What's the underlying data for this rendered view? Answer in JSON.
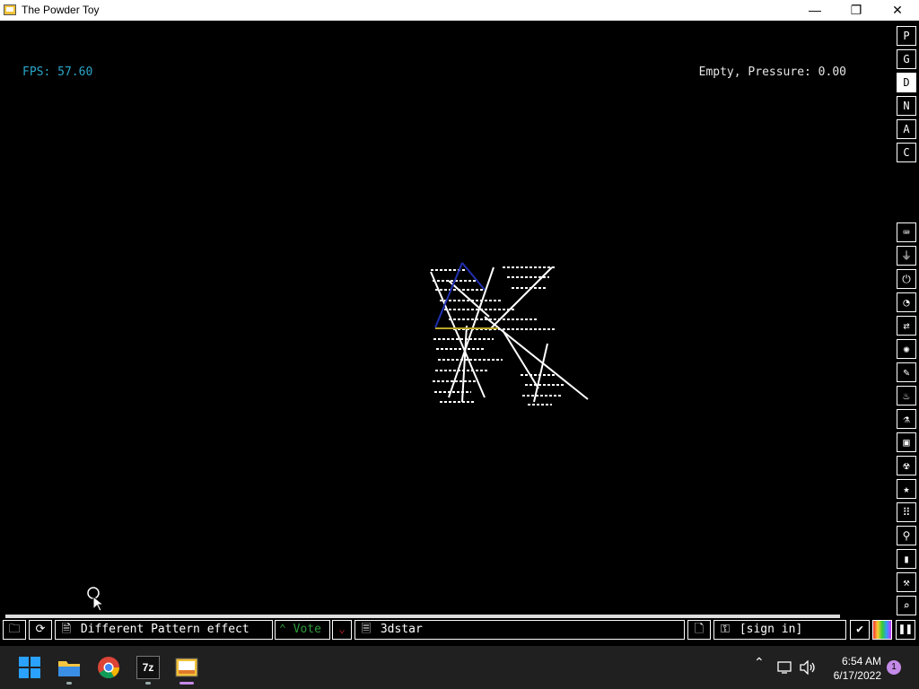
{
  "window": {
    "title": "The Powder Toy",
    "minimize_glyph": "—",
    "maximize_glyph": "❐",
    "close_glyph": "✕"
  },
  "hud": {
    "fps": "FPS: 57.60",
    "status": "Empty, Pressure: 0.00"
  },
  "side_panel_top": [
    {
      "label": "P",
      "active": false
    },
    {
      "label": "G",
      "active": false
    },
    {
      "label": "D",
      "active": true
    },
    {
      "label": "N",
      "active": false
    },
    {
      "label": "A",
      "active": false
    },
    {
      "label": "C",
      "active": false
    }
  ],
  "tool_categories": [
    {
      "icon": "keyboard-icon",
      "glyph": "⌨"
    },
    {
      "icon": "plug-icon",
      "glyph": "⏚"
    },
    {
      "icon": "power-icon",
      "glyph": "⏻"
    },
    {
      "icon": "gauge-icon",
      "glyph": "◔"
    },
    {
      "icon": "arrows-icon",
      "glyph": "⇄"
    },
    {
      "icon": "explosion-icon",
      "glyph": "✺"
    },
    {
      "icon": "pen-icon",
      "glyph": "✎"
    },
    {
      "icon": "flame-icon",
      "glyph": "♨"
    },
    {
      "icon": "flask-icon",
      "glyph": "⚗"
    },
    {
      "icon": "square-icon",
      "glyph": "▣"
    },
    {
      "icon": "radiation-icon",
      "glyph": "☢"
    },
    {
      "icon": "star-icon",
      "glyph": "★"
    },
    {
      "icon": "stairs-icon",
      "glyph": "⠿"
    },
    {
      "icon": "bulb-icon",
      "glyph": "⚲"
    },
    {
      "icon": "bookmark-icon",
      "glyph": "▮"
    },
    {
      "icon": "wrench-icon",
      "glyph": "⚒"
    },
    {
      "icon": "search-icon",
      "glyph": "⌕"
    }
  ],
  "bottom_bar": {
    "save_title": "Different Pattern effect",
    "vote_label": "Vote",
    "author": "3dstar",
    "sign_in": "[sign in]"
  },
  "taskbar": {
    "time": "6:54 AM",
    "date": "6/17/2022",
    "notification_count": "1",
    "icons": [
      "windows-start-icon",
      "file-explorer-icon",
      "chrome-icon",
      "7zip-icon",
      "powder-toy-icon"
    ],
    "zip_label": "7z"
  },
  "colors": {
    "fps": "#2aa6c9",
    "vote": "#2e9b3a",
    "downvote": "#a02020",
    "taskbar": "#202020"
  }
}
